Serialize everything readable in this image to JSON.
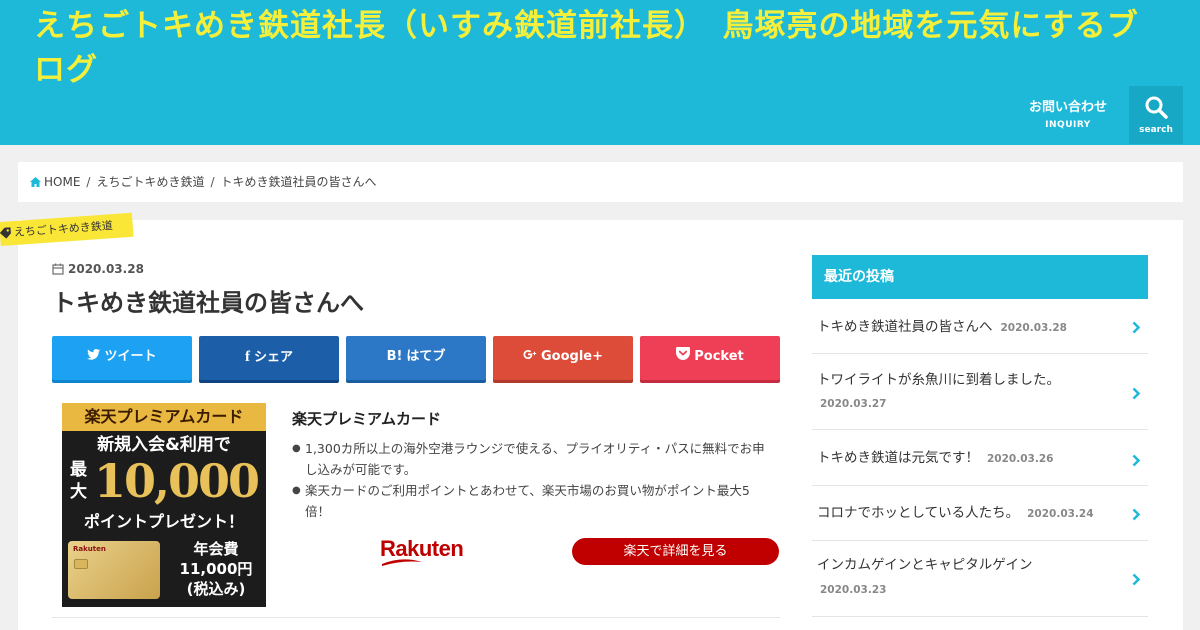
{
  "site": {
    "title": "えちごトキめき鉄道社長（いすみ鉄道前社長）　鳥塚亮の地域を元気にするブログ"
  },
  "nav": {
    "inquiry_jp": "お問い合わせ",
    "inquiry_en": "INQUIRY",
    "search_label": "search"
  },
  "breadcrumb": {
    "home": "HOME",
    "category": "えちごトキめき鉄道",
    "current": "トキめき鉄道社員の皆さんへ"
  },
  "post": {
    "category": "えちごトキめき鉄道",
    "date": "2020.03.28",
    "title": "トキめき鉄道社員の皆さんへ"
  },
  "share": {
    "twitter": "ツイート",
    "facebook": "シェア",
    "hatena_mark": "B!",
    "hatena": "はてブ",
    "google": "Google+",
    "pocket": "Pocket"
  },
  "ad": {
    "banner_top": "楽天プレミアムカード",
    "banner_line1": "新規入会&利用で",
    "banner_max": "最大",
    "banner_amount": "10,000",
    "banner_line3": "ポイントプレゼント！",
    "banner_card_brand": "Rakuten",
    "banner_fee_1": "年会費",
    "banner_fee_2": "11,000円",
    "banner_fee_3": "(税込み)",
    "title": "楽天プレミアムカード",
    "bullets": [
      "1,300カ所以上の海外空港ラウンジで使える、プライオリティ・パスに無料でお申し込みが可能です。",
      "楽天カードのご利用ポイントとあわせて、楽天市場のお買い物がポイント最大5倍！"
    ],
    "logo_text": "Rakuten",
    "button": "楽天で詳細を見る"
  },
  "sidebar": {
    "heading": "最近の投稿",
    "items": [
      {
        "title": "トキめき鉄道社員の皆さんへ",
        "date": "2020.03.28"
      },
      {
        "title": "トワイライトが糸魚川に到着しました。",
        "date": "2020.03.27"
      },
      {
        "title": "トキめき鉄道は元気です！",
        "date": "2020.03.26"
      },
      {
        "title": "コロナでホッとしている人たち。",
        "date": "2020.03.24"
      },
      {
        "title": "インカムゲインとキャピタルゲイン",
        "date": "2020.03.23"
      }
    ]
  },
  "colors": {
    "brand": "#1eb8d8",
    "title_yellow": "#f4ef3b",
    "category_yellow": "#fae636",
    "rakuten_red": "#c00000"
  }
}
